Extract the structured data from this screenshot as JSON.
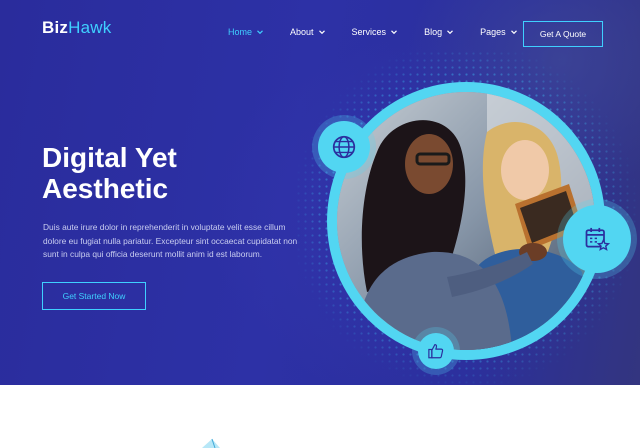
{
  "logo": {
    "part1": "Biz",
    "part2": "Hawk"
  },
  "nav": {
    "items": [
      {
        "label": "Home",
        "active": true
      },
      {
        "label": "About",
        "active": false
      },
      {
        "label": "Services",
        "active": false
      },
      {
        "label": "Blog",
        "active": false
      },
      {
        "label": "Pages",
        "active": false
      }
    ],
    "quote_button": "Get A Quote"
  },
  "hero": {
    "headline_line1": "Digital Yet",
    "headline_line2": "Aesthetic",
    "description": "Duis aute irure dolor in reprehenderit in voluptate velit esse cillum dolore eu fugiat nulla pariatur. Excepteur sint occaecat cupidatat non sunt in culpa qui officia deserunt mollit anim id est laborum.",
    "cta_button": "Get Started Now"
  },
  "icons": {
    "globe": "globe-icon",
    "calendar": "calendar-star-icon",
    "like": "thumbs-up-icon"
  },
  "colors": {
    "hero_background": "#2b2f9e",
    "accent": "#3fd0ff",
    "ring": "#52d6f2",
    "text": "#ffffff"
  }
}
